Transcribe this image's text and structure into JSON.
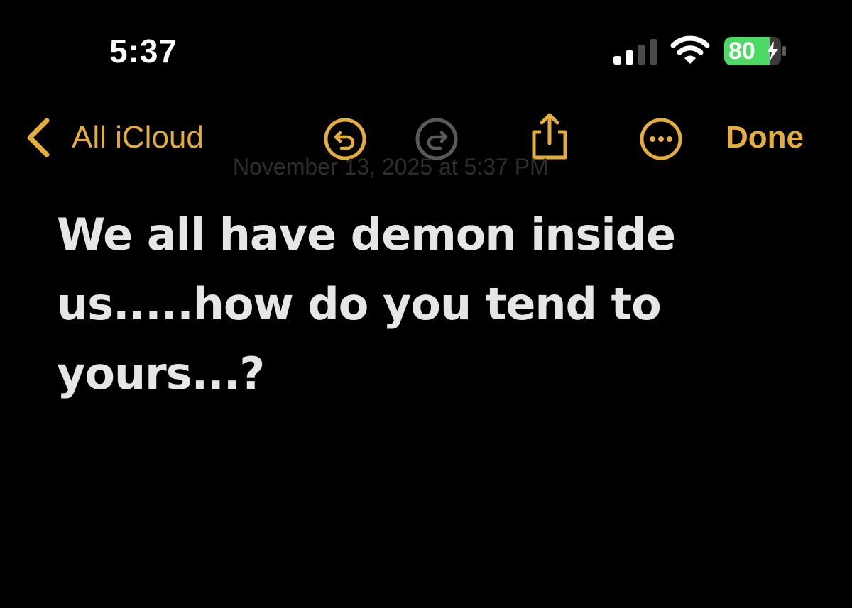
{
  "status_bar": {
    "time": "5:37",
    "battery_percent": "80",
    "signal_bars_active": 2,
    "signal_bars_total": 4,
    "battery_charging": true,
    "icons": [
      "cellular-signal-icon",
      "wifi-icon",
      "battery-charging-icon"
    ],
    "battery_color": "#4cd964"
  },
  "toolbar": {
    "back_label": "All iCloud",
    "done_label": "Done",
    "icons": [
      "chevron-left-icon",
      "undo-icon",
      "redo-icon",
      "share-icon",
      "more-icon"
    ],
    "accent_color": "#e3ae3c",
    "disabled_color": "#5a5a5a",
    "redo_enabled": false
  },
  "note": {
    "date": "November 13, 2025 at 5:37 PM",
    "body": "We all have demon inside\nus.....how do you tend to\nyours...?"
  }
}
